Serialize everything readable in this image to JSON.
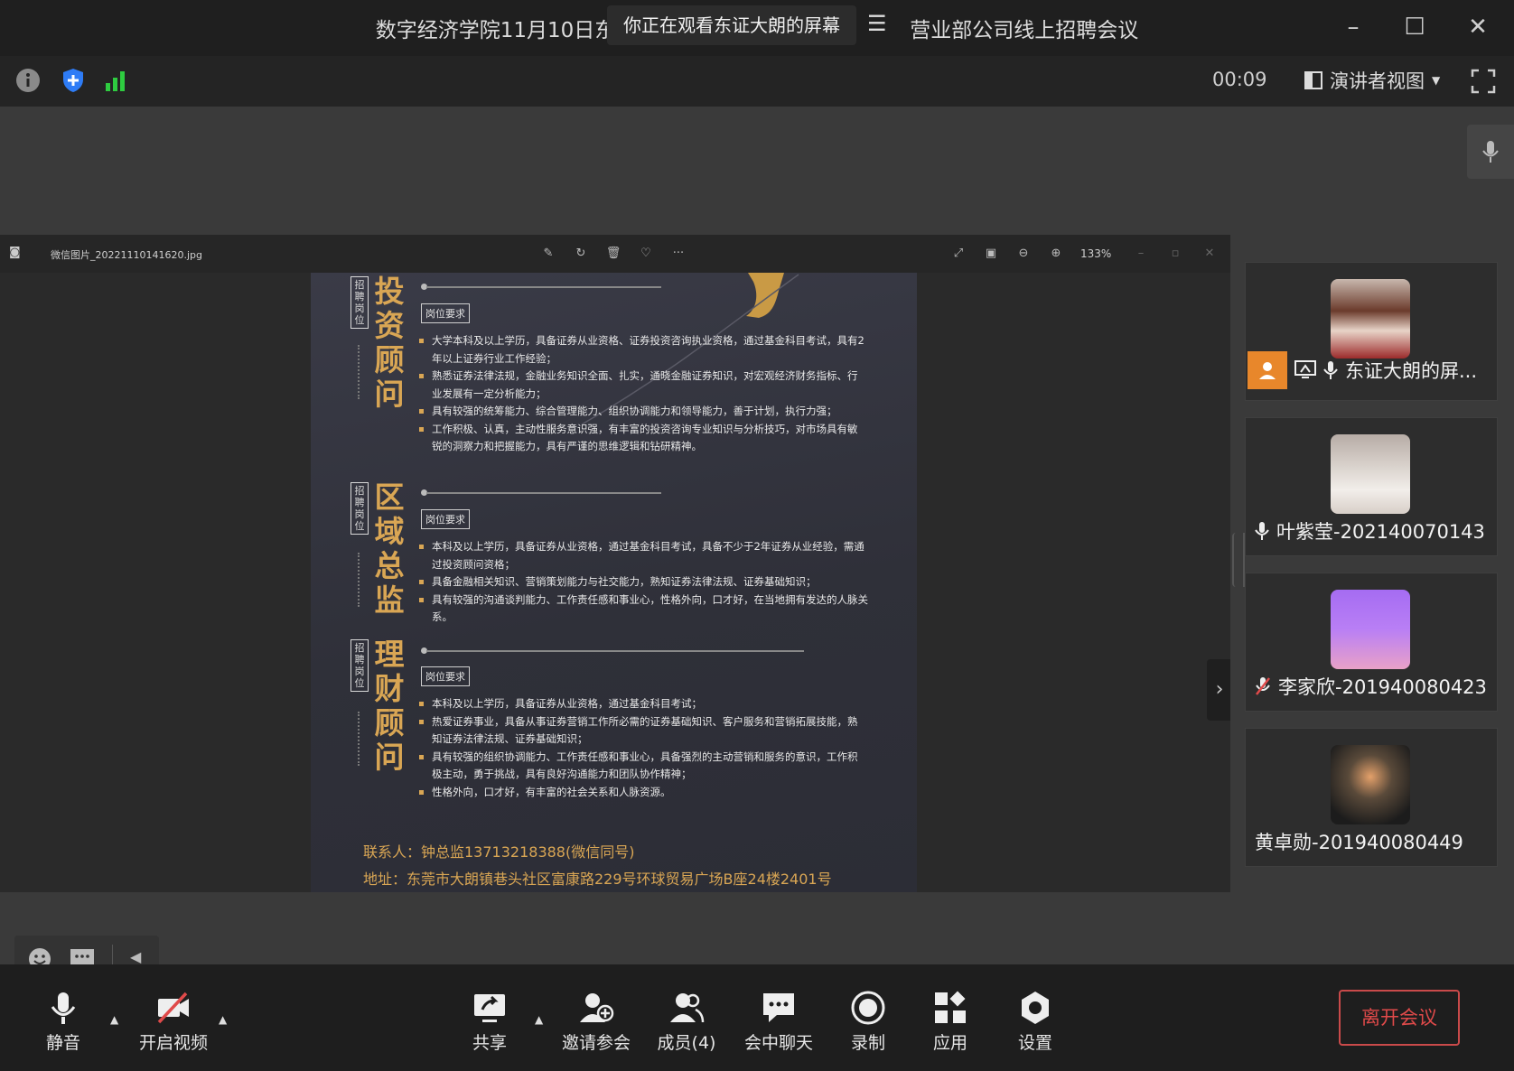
{
  "window": {
    "title_left": "数字经济学院11月10日东",
    "title_right": "营业部公司线上招聘会议",
    "share_notice": "你正在观看东证大朗的屏幕"
  },
  "infobar": {
    "timer": "00:09",
    "view_mode": "演讲者视图"
  },
  "viewer": {
    "filename": "微信图片_20221110141620.jpg",
    "zoom": "133%"
  },
  "poster": {
    "tag": "招聘岗位",
    "req_label": "岗位要求",
    "sections": [
      {
        "title": "投资顾问",
        "items": [
          "大学本科及以上学历，具备证券从业资格、证券投资咨询执业资格，通过基金科目考试，具有2年以上证券行业工作经验；",
          "熟悉证券法律法规，金融业务知识全面、扎实，通晓金融证券知识，对宏观经济财务指标、行业发展有一定分析能力；",
          "具有较强的统筹能力、综合管理能力、组织协调能力和领导能力，善于计划，执行力强；",
          "工作积极、认真，主动性服务意识强，有丰富的投资咨询专业知识与分析技巧，对市场具有敏锐的洞察力和把握能力，具有严谨的思维逻辑和钻研精神。"
        ]
      },
      {
        "title": "区域总监",
        "items": [
          "本科及以上学历，具备证券从业资格，通过基金科目考试，具备不少于2年证券从业经验，需通过投资顾问资格；",
          "具备金融相关知识、营销策划能力与社交能力，熟知证券法律法规、证券基础知识；",
          "具有较强的沟通谈判能力、工作责任感和事业心，性格外向，口才好，在当地拥有发达的人脉关系。"
        ]
      },
      {
        "title": "理财顾问",
        "items": [
          "本科及以上学历，具备证券从业资格，通过基金科目考试；",
          "热爱证券事业，具备从事证券营销工作所必需的证券基础知识、客户服务和营销拓展技能，熟知证券法律法规、证券基础知识；",
          "具有较强的组织协调能力、工作责任感和事业心，具备强烈的主动营销和服务的意识，工作积极主动，勇于挑战，具有良好沟通能力和团队协作精神；",
          "性格外向，口才好，有丰富的社会关系和人脉资源。"
        ]
      }
    ],
    "contact": "联系人：钟总监13713218388(微信同号)",
    "address": "地址：东莞市大朗镇巷头社区富康路229号环球贸易广场B座24楼2401号"
  },
  "participants": [
    {
      "name": "东证大朗的屏...",
      "mic": "on",
      "host": true,
      "sharing": true
    },
    {
      "name": "叶紫莹-202140070143",
      "mic": "on"
    },
    {
      "name": "李家欣-201940080423",
      "mic": "muted"
    },
    {
      "name": "黄卓勋-201940080449",
      "mic": "none"
    }
  ],
  "toolbar": {
    "mute": "静音",
    "video": "开启视频",
    "share": "共享",
    "invite": "邀请参会",
    "members": "成员(4)",
    "chat": "会中聊天",
    "record": "录制",
    "apps": "应用",
    "settings": "设置",
    "leave": "离开会议"
  },
  "colors": {
    "accent_gold": "#d9a654",
    "leave_red": "#e04a4a",
    "signal_green": "#2ecc40",
    "shield_blue": "#2e7cf6",
    "host_orange": "#e8872b"
  }
}
